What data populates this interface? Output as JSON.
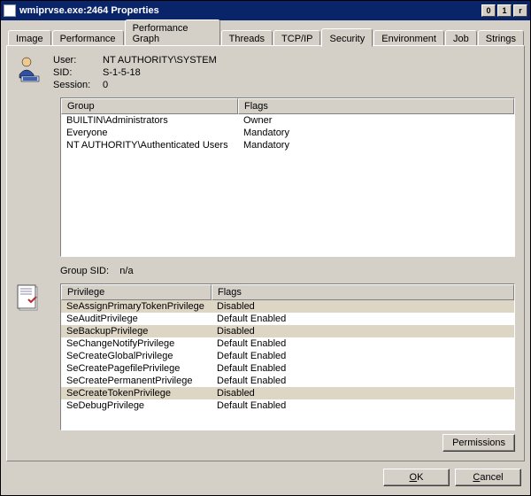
{
  "window": {
    "title": "wmiprvse.exe:2464 Properties"
  },
  "tabs": [
    "Image",
    "Performance",
    "Performance Graph",
    "Threads",
    "TCP/IP",
    "Security",
    "Environment",
    "Job",
    "Strings"
  ],
  "activeTab": "Security",
  "info": {
    "userLabel": "User:",
    "userValue": "NT AUTHORITY\\SYSTEM",
    "sidLabel": "SID:",
    "sidValue": "S-1-5-18",
    "sessionLabel": "Session:",
    "sessionValue": "0"
  },
  "groups": {
    "headers": {
      "group": "Group",
      "flags": "Flags"
    },
    "rows": [
      {
        "group": "BUILTIN\\Administrators",
        "flags": "Owner"
      },
      {
        "group": "Everyone",
        "flags": "Mandatory"
      },
      {
        "group": "NT AUTHORITY\\Authenticated Users",
        "flags": "Mandatory"
      }
    ]
  },
  "groupSid": {
    "label": "Group SID:",
    "value": "n/a"
  },
  "privs": {
    "headers": {
      "priv": "Privilege",
      "flags": "Flags"
    },
    "rows": [
      {
        "priv": "SeAssignPrimaryTokenPrivilege",
        "flags": "Disabled",
        "shaded": true
      },
      {
        "priv": "SeAuditPrivilege",
        "flags": "Default Enabled",
        "shaded": false
      },
      {
        "priv": "SeBackupPrivilege",
        "flags": "Disabled",
        "shaded": true
      },
      {
        "priv": "SeChangeNotifyPrivilege",
        "flags": "Default Enabled",
        "shaded": false
      },
      {
        "priv": "SeCreateGlobalPrivilege",
        "flags": "Default Enabled",
        "shaded": false
      },
      {
        "priv": "SeCreatePagefilePrivilege",
        "flags": "Default Enabled",
        "shaded": false
      },
      {
        "priv": "SeCreatePermanentPrivilege",
        "flags": "Default Enabled",
        "shaded": false
      },
      {
        "priv": "SeCreateTokenPrivilege",
        "flags": "Disabled",
        "shaded": true
      },
      {
        "priv": "SeDebugPrivilege",
        "flags": "Default Enabled",
        "shaded": false
      }
    ]
  },
  "buttons": {
    "permissions": "Permissions",
    "ok": "OK",
    "cancel": "Cancel"
  }
}
